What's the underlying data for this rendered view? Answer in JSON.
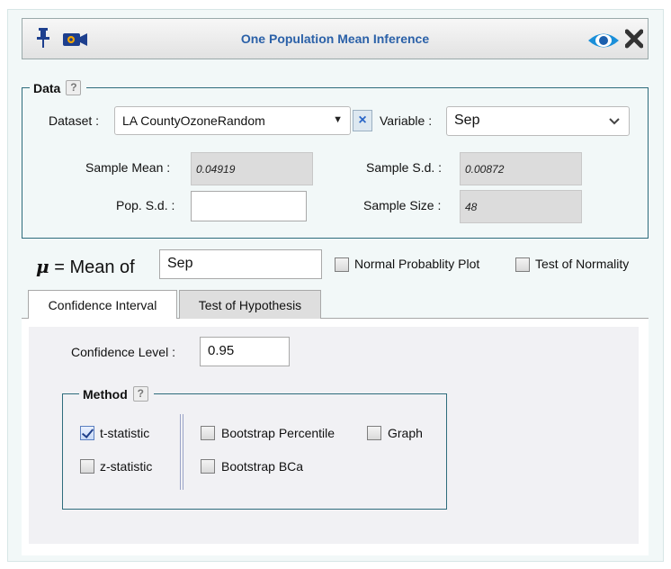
{
  "window": {
    "title": "One Population Mean Inference",
    "icons": [
      "pin-icon",
      "video-camera-icon",
      "eye-icon",
      "close-icon"
    ]
  },
  "data_section": {
    "legend": "Data",
    "help": "?",
    "dataset_label": "Dataset :",
    "dataset_value": "LA CountyOzoneRandom",
    "variable_label": "Variable :",
    "variable_value": "Sep",
    "sample_mean_label": "Sample Mean :",
    "sample_mean_value": "0.04919",
    "sample_sd_label": "Sample S.d. :",
    "sample_sd_value": "0.00872",
    "pop_sd_label": "Pop. S.d. :",
    "pop_sd_value": "",
    "sample_size_label": "Sample Size :",
    "sample_size_value": "48"
  },
  "mean_row": {
    "mu_symbol": "μ",
    "label": "= Mean of",
    "value": "Sep",
    "normal_plot_label": "Normal Probablity Plot",
    "normal_plot_checked": false,
    "normality_test_label": "Test of Normality",
    "normality_test_checked": false
  },
  "tabs": [
    {
      "label": "Confidence Interval",
      "active": true
    },
    {
      "label": "Test of Hypothesis",
      "active": false
    }
  ],
  "confidence": {
    "label": "Confidence Level :",
    "value": "0.95"
  },
  "method": {
    "legend": "Method",
    "help": "?",
    "options": [
      {
        "label": "t-statistic",
        "checked": true
      },
      {
        "label": "z-statistic",
        "checked": false
      },
      {
        "label": "Bootstrap Percentile",
        "checked": false
      },
      {
        "label": "Bootstrap BCa",
        "checked": false
      },
      {
        "label": "Graph",
        "checked": false
      }
    ]
  },
  "colors": {
    "title": "#2b61a8",
    "panel_bg": "#f2f8f8",
    "border": "#2e6c7c"
  }
}
